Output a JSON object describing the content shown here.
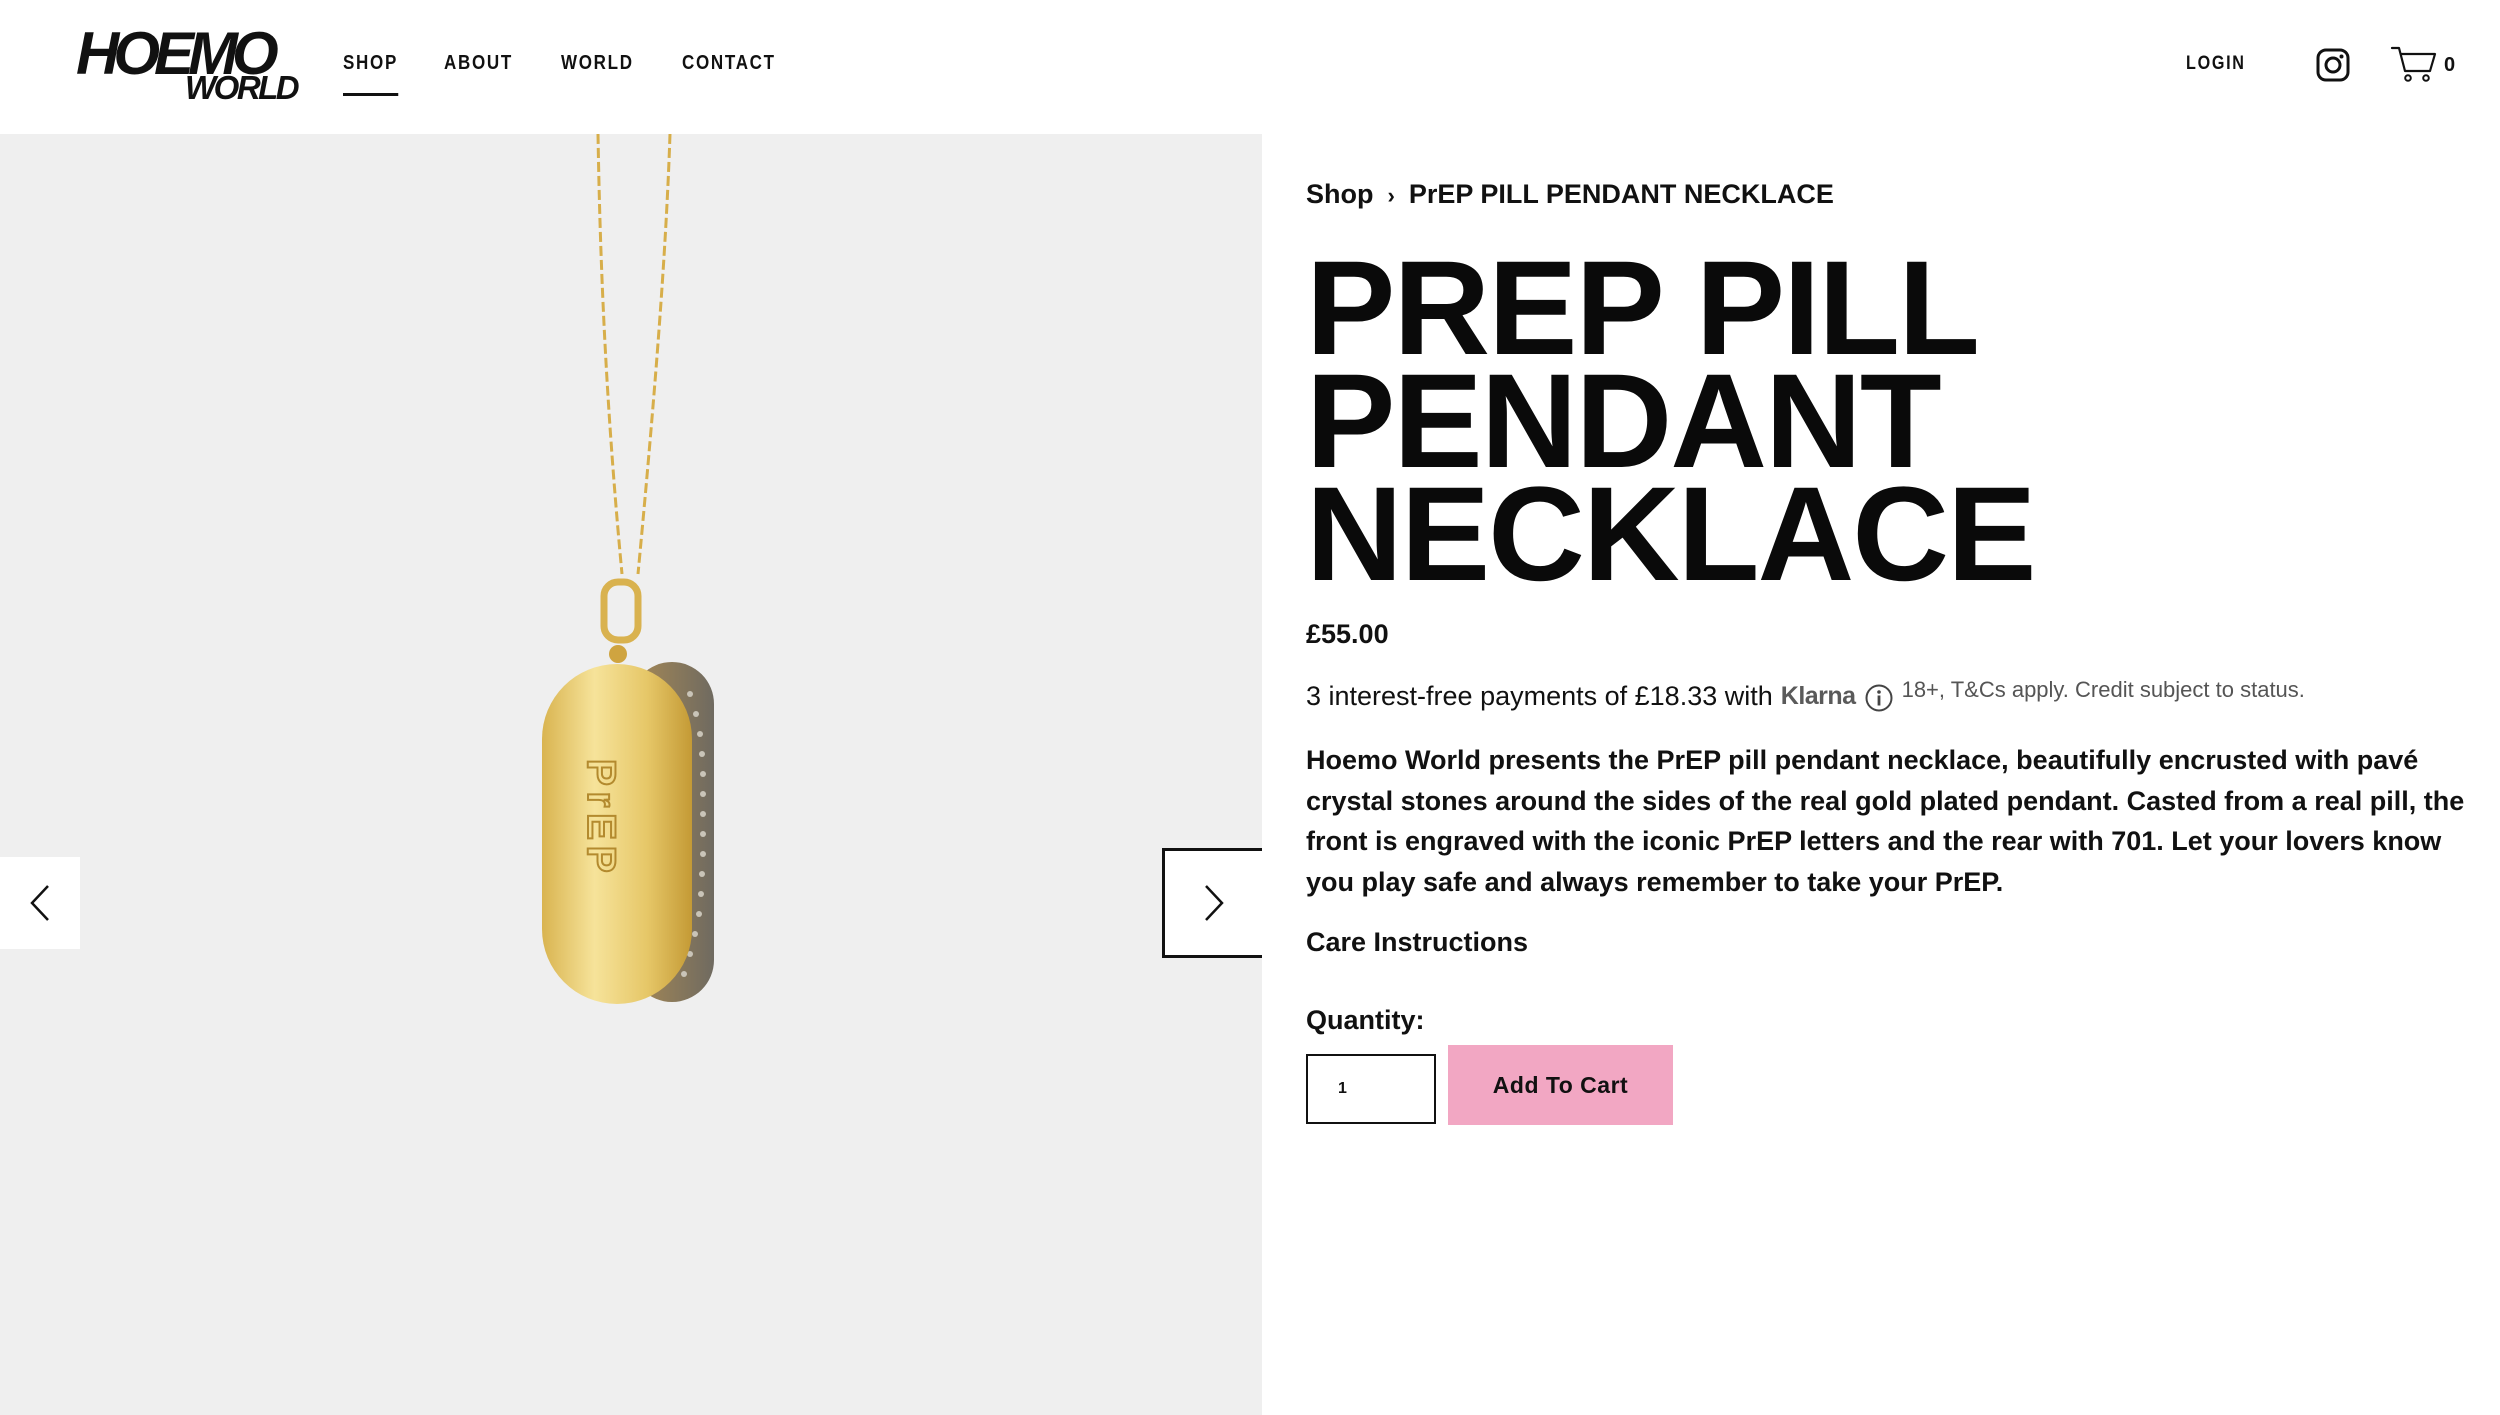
{
  "brand": {
    "logo_line1": "HOEMO",
    "logo_line2": "WORLD"
  },
  "nav": {
    "items": [
      {
        "label": "SHOP",
        "active": true
      },
      {
        "label": "ABOUT",
        "active": false
      },
      {
        "label": "WORLD",
        "active": false
      },
      {
        "label": "CONTACT",
        "active": false
      }
    ],
    "login_label": "LOGIN",
    "cart_count": "0"
  },
  "gallery": {
    "pendant_engraving": "PrEP"
  },
  "product": {
    "breadcrumb": [
      "Shop",
      "PrEP PILL PENDANT NECKLACE"
    ],
    "breadcrumb_separator": "›",
    "title": "PREP PILL PENDANT NECKLACE",
    "price": "£55.00",
    "klarna": {
      "text": "3 interest-free payments of £18.33 with",
      "brand": "Klarna",
      "terms": "18+, T&Cs apply. Credit subject to status."
    },
    "description": "Hoemo World presents the PrEP pill pendant necklace, beautifully encrusted with pavé crystal stones around the sides of the real gold plated pendant. Casted from a real pill, the front is engraved with the iconic PrEP letters and the rear with 701. Let your lovers know you play safe and always remember to take your PrEP.",
    "care_label": "Care Instructions",
    "quantity_label": "Quantity:",
    "quantity_value": "1",
    "add_to_cart_label": "Add To Cart"
  },
  "colors": {
    "accent_pink": "#f2a7c3",
    "gallery_bg": "#efefef",
    "gold": "#e3c15a"
  }
}
